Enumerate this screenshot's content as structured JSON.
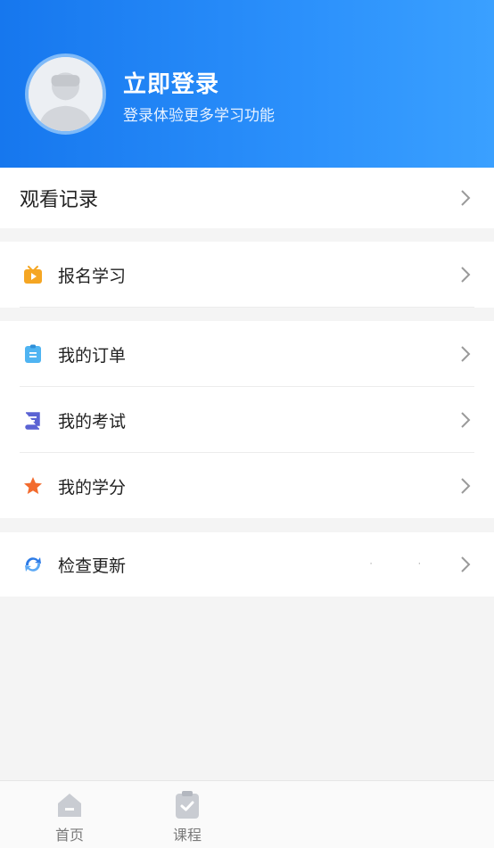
{
  "header": {
    "title": "立即登录",
    "subtitle": "登录体验更多学习功能",
    "avatar_icon": "default-user-avatar"
  },
  "sections": {
    "history": {
      "label": "观看记录"
    },
    "signup": {
      "label": "报名学习",
      "icon": "tv-icon",
      "icon_color": "#f5a623"
    },
    "orders": {
      "label": "我的订单",
      "icon": "clipboard-icon",
      "icon_color": "#3aa7f0"
    },
    "exams": {
      "label": "我的考试",
      "icon": "book-icon",
      "icon_color": "#5b63d3"
    },
    "credits": {
      "label": "我的学分",
      "icon": "star-icon",
      "icon_color": "#f26b2e"
    },
    "update": {
      "label": "检查更新",
      "icon": "refresh-icon",
      "icon_color": "#2d7be6",
      "trailing": "· ·"
    }
  },
  "tabbar": {
    "items": [
      {
        "label": "首页",
        "icon": "home-icon"
      },
      {
        "label": "课程",
        "icon": "course-clipboard-icon"
      }
    ]
  },
  "colors": {
    "header_gradient_start": "#1677ee",
    "header_gradient_end": "#3aa0ff",
    "background": "#f4f4f4"
  }
}
